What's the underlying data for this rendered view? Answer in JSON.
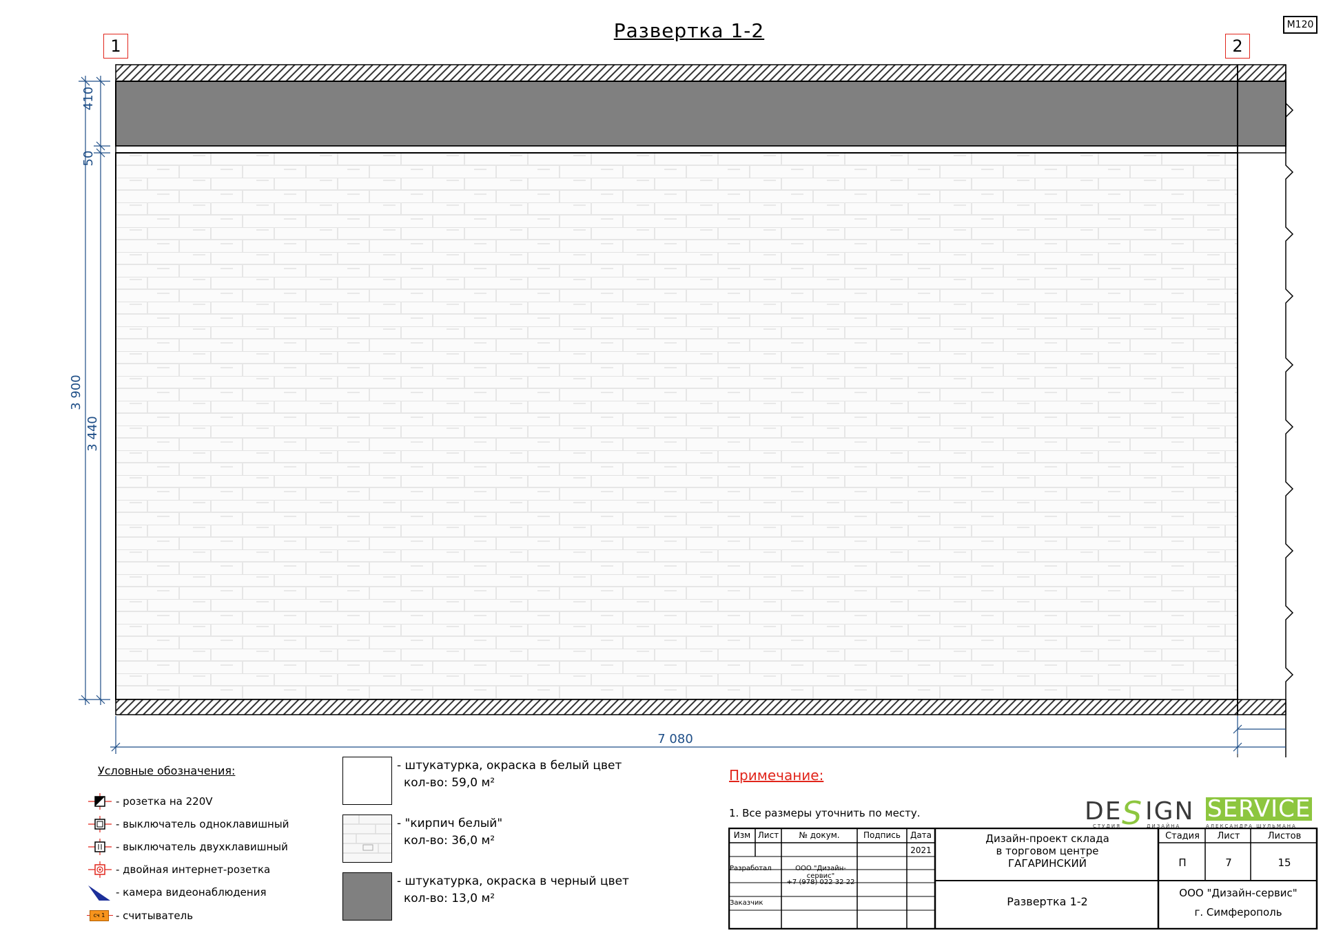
{
  "title": "Развертка 1-2",
  "scale": "М120",
  "axes": {
    "left": "1",
    "right": "2"
  },
  "dimensions": {
    "vertical": [
      "410",
      "50",
      "3 440",
      "3 900"
    ],
    "horizontal": "7 080"
  },
  "legend": {
    "title": "Условные обозначения:",
    "items": [
      {
        "icon": "socket-220v-icon",
        "label": "- розетка на 220V"
      },
      {
        "icon": "switch-single-icon",
        "label": "- выключатель одноклавишный"
      },
      {
        "icon": "switch-double-icon",
        "label": "- выключатель двухклавишный"
      },
      {
        "icon": "internet-socket-icon",
        "label": "- двойная интернет-розетка"
      },
      {
        "icon": "camera-icon",
        "label": "- камера видеонаблюдения"
      },
      {
        "icon": "reader-icon",
        "label": "- считыватель",
        "tag": "сч 1"
      }
    ]
  },
  "materials": [
    {
      "pattern": "white-plaster",
      "line1": "- штукатурка, окраска в белый цвет",
      "line2": "кол-во: 59,0 м²",
      "color": "#ffffff"
    },
    {
      "pattern": "white-brick",
      "line1": "- \"кирпич белый\"",
      "line2": "кол-во: 36,0 м²",
      "color": "#f4f4f4"
    },
    {
      "pattern": "black-plaster",
      "line1": "- штукатурка, окраска в черный цвет",
      "line2": "кол-во: 13,0 м²",
      "color": "#808080"
    }
  ],
  "notes": {
    "title": "Примечание:",
    "items": [
      "1. Все размеры уточнить по месту."
    ]
  },
  "logo": {
    "word1": "DE",
    "s": "S",
    "word2": "IGN",
    "word3": "SERVICE",
    "sub1": "СТУДИЯ",
    "sub2": "ДИЗАЙНА",
    "sub3": "АЛЕКСАНДРА ШУЛЬМАНА",
    "colors": {
      "dark": "#3a3a3a",
      "green": "#8dc63f"
    }
  },
  "stamp": {
    "headers": {
      "izm": "Изм",
      "list": "Лист",
      "ndoc": "№ докум.",
      "sign": "Подпись",
      "date": "Дата"
    },
    "year": "2021",
    "developed_label": "Разработал",
    "developer": "ООО \"Дизайн-сервис\"",
    "phone": "+7 (978) 022 32 22",
    "customer_label": "Заказчик",
    "project_line1": "Дизайн-проект склада",
    "project_line2": "в торговом центре",
    "project_line3": "ГАГАРИНСКИЙ",
    "sheet_title": "Развертка 1-2",
    "stage_label": "Стадия",
    "sheet_label": "Лист",
    "sheets_label": "Листов",
    "stage": "П",
    "sheet_no": "7",
    "sheets_total": "15",
    "company": "ООО \"Дизайн-сервис\"",
    "city": "г. Симферополь"
  }
}
